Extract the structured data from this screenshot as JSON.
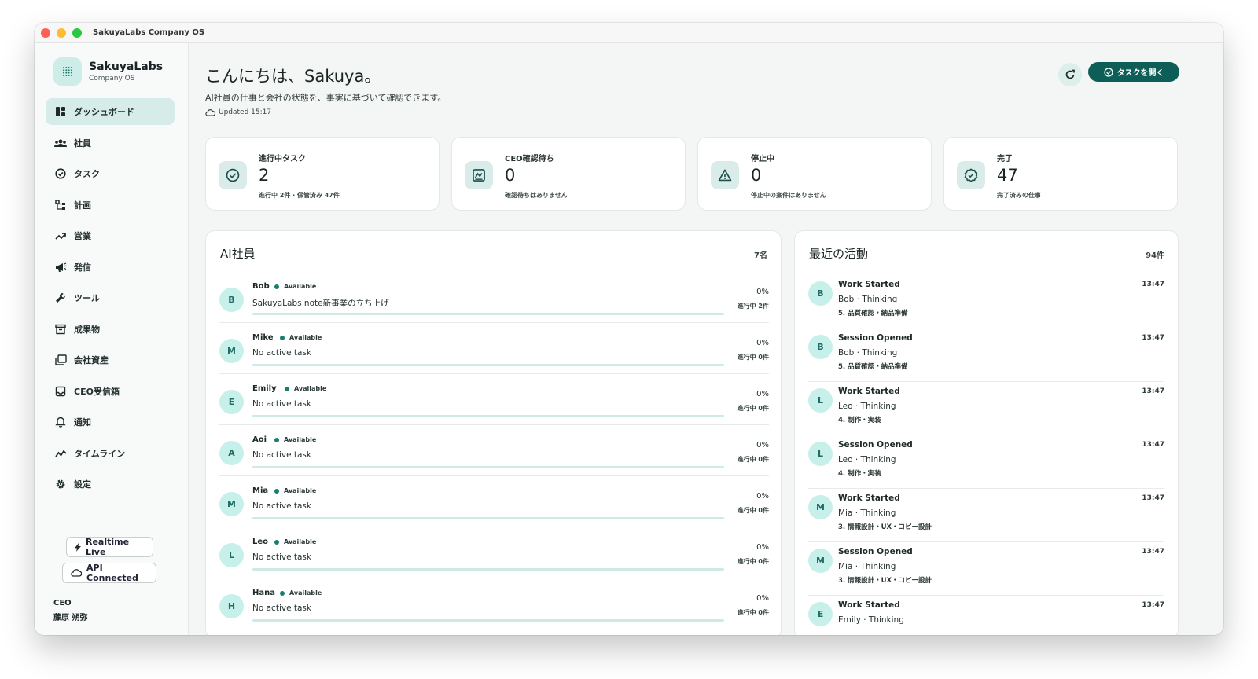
{
  "window": {
    "title": "SakuyaLabs Company OS"
  },
  "brand": {
    "name": "SakuyaLabs",
    "subtitle": "Company OS"
  },
  "sidebar": {
    "items": [
      {
        "label": "ダッシュボード",
        "icon": "dashboard-icon",
        "active": true
      },
      {
        "label": "社員",
        "icon": "people-icon"
      },
      {
        "label": "タスク",
        "icon": "check-circle-icon"
      },
      {
        "label": "計画",
        "icon": "hierarchy-icon"
      },
      {
        "label": "営業",
        "icon": "trend-icon"
      },
      {
        "label": "発信",
        "icon": "megaphone-icon"
      },
      {
        "label": "ツール",
        "icon": "wrench-icon"
      },
      {
        "label": "成果物",
        "icon": "archive-icon"
      },
      {
        "label": "会社資産",
        "icon": "copy-icon"
      },
      {
        "label": "CEO受信箱",
        "icon": "inbox-icon"
      },
      {
        "label": "通知",
        "icon": "bell-icon"
      },
      {
        "label": "タイムライン",
        "icon": "activity-icon"
      },
      {
        "label": "設定",
        "icon": "gear-icon"
      }
    ],
    "realtime_label": "Realtime Live",
    "api_label": "API Connected",
    "ceo_role": "CEO",
    "ceo_name": "藤原 朔弥"
  },
  "header": {
    "greeting": "こんにちは、Sakuya。",
    "subtitle": "AI社員の仕事と会社の状態を、事実に基づいて確認できます。",
    "updated": "Updated 15:17",
    "open_tasks_label": "タスクを開く"
  },
  "stats": [
    {
      "label": "進行中タスク",
      "value": "2",
      "note": "進行中 2件 · 保管済み 47件",
      "icon": "check-circle-icon"
    },
    {
      "label": "CEO確認待ち",
      "value": "0",
      "note": "確認待ちはありません",
      "icon": "signature-icon"
    },
    {
      "label": "停止中",
      "value": "0",
      "note": "停止中の案件はありません",
      "icon": "warning-icon"
    },
    {
      "label": "完了",
      "value": "47",
      "note": "完了済みの仕事",
      "icon": "verified-icon"
    }
  ],
  "employees": {
    "title": "AI社員",
    "count": "7名",
    "rows": [
      {
        "initial": "B",
        "name": "Bob",
        "status": "Available",
        "task": "SakuyaLabs note新事業の立ち上げ",
        "percent": "0%",
        "progress": 0,
        "active_count": "進行中 2件"
      },
      {
        "initial": "M",
        "name": "Mike",
        "status": "Available",
        "task": "No active task",
        "percent": "0%",
        "progress": 0,
        "active_count": "進行中 0件"
      },
      {
        "initial": "E",
        "name": "Emily",
        "status": "Available",
        "task": "No active task",
        "percent": "0%",
        "progress": 0,
        "active_count": "進行中 0件"
      },
      {
        "initial": "A",
        "name": "Aoi",
        "status": "Available",
        "task": "No active task",
        "percent": "0%",
        "progress": 0,
        "active_count": "進行中 0件"
      },
      {
        "initial": "M",
        "name": "Mia",
        "status": "Available",
        "task": "No active task",
        "percent": "0%",
        "progress": 0,
        "active_count": "進行中 0件"
      },
      {
        "initial": "L",
        "name": "Leo",
        "status": "Available",
        "task": "No active task",
        "percent": "0%",
        "progress": 0,
        "active_count": "進行中 0件"
      },
      {
        "initial": "H",
        "name": "Hana",
        "status": "Available",
        "task": "No active task",
        "percent": "0%",
        "progress": 0,
        "active_count": "進行中 0件"
      }
    ]
  },
  "activity": {
    "title": "最近の活動",
    "count": "94件",
    "rows": [
      {
        "initial": "B",
        "title": "Work Started",
        "time": "13:47",
        "who": "Bob · Thinking",
        "phase": "5. 品質確認・納品準備"
      },
      {
        "initial": "B",
        "title": "Session Opened",
        "time": "13:47",
        "who": "Bob · Thinking",
        "phase": "5. 品質確認・納品準備"
      },
      {
        "initial": "L",
        "title": "Work Started",
        "time": "13:47",
        "who": "Leo · Thinking",
        "phase": "4. 制作・実装"
      },
      {
        "initial": "L",
        "title": "Session Opened",
        "time": "13:47",
        "who": "Leo · Thinking",
        "phase": "4. 制作・実装"
      },
      {
        "initial": "M",
        "title": "Work Started",
        "time": "13:47",
        "who": "Mia · Thinking",
        "phase": "3. 情報設計・UX・コピー設計"
      },
      {
        "initial": "M",
        "title": "Session Opened",
        "time": "13:47",
        "who": "Mia · Thinking",
        "phase": "3. 情報設計・UX・コピー設計"
      },
      {
        "initial": "E",
        "title": "Work Started",
        "time": "13:47",
        "who": "Emily · Thinking",
        "phase": ""
      }
    ]
  },
  "colors": {
    "accent": "#0d5e57",
    "accent_light": "#d6ece8",
    "status_dot": "#15806f"
  }
}
